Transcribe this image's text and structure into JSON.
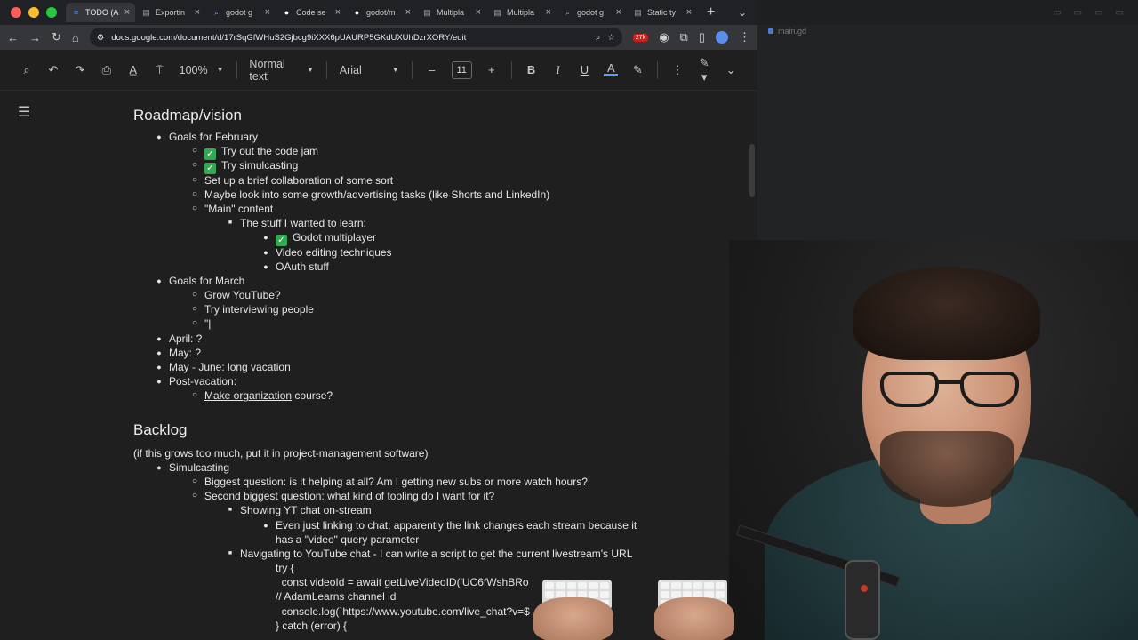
{
  "browser": {
    "tabs": [
      {
        "label": "TODO (A",
        "icon": "docs-icon",
        "color": "#4285f4",
        "active": true
      },
      {
        "label": "Exportin",
        "icon": "page-icon",
        "color": "#9aa0a6",
        "active": false
      },
      {
        "label": "godot g",
        "icon": "search-icon",
        "color": "#8ab4f8",
        "active": false
      },
      {
        "label": "Code se",
        "icon": "github-icon",
        "color": "#ffffff",
        "active": false
      },
      {
        "label": "godot/m",
        "icon": "github-icon",
        "color": "#ffffff",
        "active": false
      },
      {
        "label": "Multipla",
        "icon": "page-icon",
        "color": "#9aa0a6",
        "active": false
      },
      {
        "label": "Multipla",
        "icon": "page-icon",
        "color": "#9aa0a6",
        "active": false
      },
      {
        "label": "godot g",
        "icon": "search-icon",
        "color": "#8ab4f8",
        "active": false
      },
      {
        "label": "Static ty",
        "icon": "page-icon",
        "color": "#9aa0a6",
        "active": false
      }
    ],
    "url": "docs.google.com/document/d/17rSqGfWHuS2Gjbcg9iXXX6pUAURP5GKdUXUhDzrXORY/edit",
    "extension_badge": "27k"
  },
  "toolbar": {
    "zoom": "100%",
    "style": "Normal text",
    "font": "Arial",
    "font_size": "11"
  },
  "document": {
    "heading1": "Roadmap/vision",
    "roadmap": [
      {
        "level": 0,
        "text": "Goals for February"
      },
      {
        "level": 1,
        "text": "Try out the code jam",
        "checked": true
      },
      {
        "level": 1,
        "text": "Try simulcasting",
        "checked": true
      },
      {
        "level": 1,
        "text": "Set up a brief collaboration of some sort"
      },
      {
        "level": 1,
        "text": "Maybe look into some growth/advertising tasks (like Shorts and LinkedIn)"
      },
      {
        "level": 1,
        "text": "\"Main\" content"
      },
      {
        "level": 2,
        "text": "The stuff I wanted to learn:"
      },
      {
        "level": 3,
        "text": "Godot multiplayer",
        "checked": true
      },
      {
        "level": 3,
        "text": "Video editing techniques"
      },
      {
        "level": 3,
        "text": "OAuth stuff"
      },
      {
        "level": 0,
        "text": "Goals for March"
      },
      {
        "level": 1,
        "text": "Grow YouTube?"
      },
      {
        "level": 1,
        "text": "Try interviewing people"
      },
      {
        "level": 1,
        "text": "\"|"
      },
      {
        "level": 0,
        "text": "April: ?"
      },
      {
        "level": 0,
        "text": "May: ?"
      },
      {
        "level": 0,
        "text": "May - June: long vacation"
      },
      {
        "level": 0,
        "text": "Post-vacation:"
      },
      {
        "level": 1,
        "text": "Make organization course?",
        "underline_part": "Make organization",
        "rest": " course?"
      }
    ],
    "heading2": "Backlog",
    "backlog_note": "(if this grows too much, put it in project-management software)",
    "backlog": [
      {
        "level": 0,
        "text": "Simulcasting"
      },
      {
        "level": 1,
        "text": "Biggest question: is it helping at all? Am I getting new subs or more watch hours?"
      },
      {
        "level": 1,
        "text": "Second biggest question: what kind of tooling do I want for it?"
      },
      {
        "level": 2,
        "text": "Showing YT chat on-stream"
      },
      {
        "level": 3,
        "text": "Even just linking to chat; apparently the link changes each stream because it"
      },
      {
        "level": 3,
        "text": "has a \"video\" query parameter",
        "nobullet": true
      },
      {
        "level": 2,
        "text": "Navigating to YouTube chat - I can write a script to get the current livestream's URL"
      },
      {
        "level": 3,
        "text": "try {",
        "nobullet": true
      },
      {
        "level": 3,
        "text": "  const videoId = await getLiveVideoID('UC6fWshBRo",
        "nobullet": true
      },
      {
        "level": 3,
        "text": "// AdamLearns channel id",
        "nobullet": true
      },
      {
        "level": 3,
        "text": "  console.log(`https://www.youtube.com/live_chat?v=$",
        "nobullet": true
      },
      {
        "level": 3,
        "text": "} catch (error) {",
        "nobullet": true
      }
    ]
  },
  "editor": {
    "file_tab": "main.gd"
  }
}
